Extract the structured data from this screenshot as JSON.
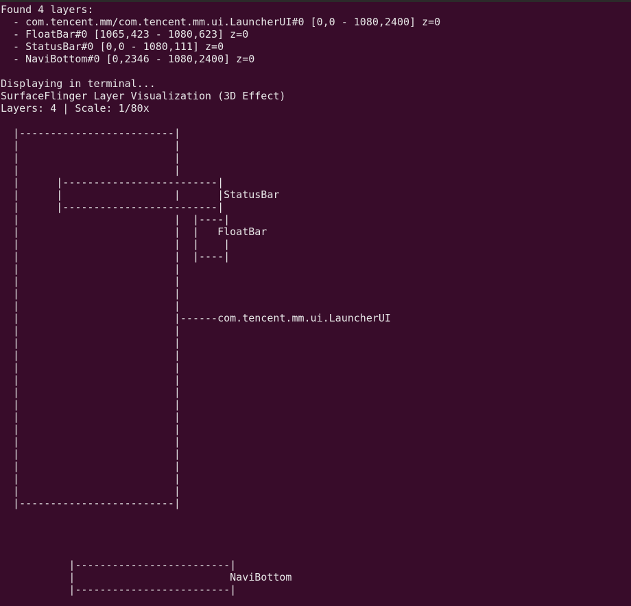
{
  "terminal": {
    "background": "#380c2a",
    "text_color": "#e7e7e7",
    "lines": [
      "Found 4 layers:",
      "  - com.tencent.mm/com.tencent.mm.ui.LauncherUI#0 [0,0 - 1080,2400] z=0",
      "  - FloatBar#0 [1065,423 - 1080,623] z=0",
      "  - StatusBar#0 [0,0 - 1080,111] z=0",
      "  - NaviBottom#0 [0,2346 - 1080,2400] z=0",
      "",
      "Displaying in terminal...",
      "SurfaceFlinger Layer Visualization (3D Effect)",
      "Layers: 4 | Scale: 1/80x",
      "",
      "  |-------------------------|",
      "  |                         |",
      "  |                         |",
      "  |                         |",
      "  |      |-------------------------|",
      "  |      |                  |      |StatusBar",
      "  |      |-------------------------|",
      "  |                         |  |----|",
      "  |                         |  |   FloatBar",
      "  |                         |  |    |",
      "  |                         |  |----|",
      "  |                         |",
      "  |                         |",
      "  |                         |",
      "  |                         |",
      "  |                         |------com.tencent.mm.ui.LauncherUI",
      "  |                         |",
      "  |                         |",
      "  |                         |",
      "  |                         |",
      "  |                         |",
      "  |                         |",
      "  |                         |",
      "  |                         |",
      "  |                         |",
      "  |                         |",
      "  |                         |",
      "  |                         |",
      "  |                         |",
      "  |                         |",
      "  |-------------------------|",
      "",
      "",
      "",
      "",
      "           |-------------------------|",
      "           |                         NaviBottom",
      "           |-------------------------|"
    ]
  }
}
